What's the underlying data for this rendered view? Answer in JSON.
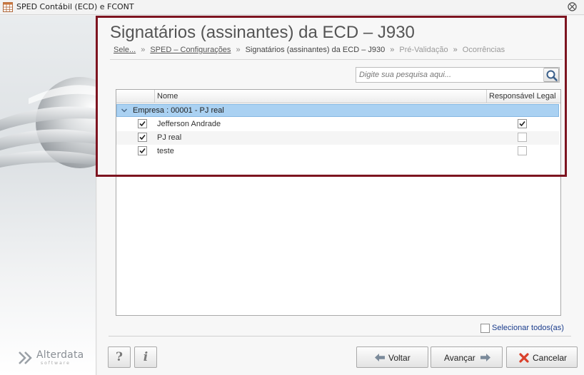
{
  "window": {
    "title": "SPED Contábil (ECD) e FCONT",
    "close_glyph": "⨂"
  },
  "header": {
    "title": "Signatários (assinantes) da ECD – J930",
    "breadcrumb": {
      "items": [
        "Sele...",
        "SPED – Configurações",
        "Signatários (assinantes) da ECD – J930",
        "Pré-Validação",
        "Ocorrências"
      ],
      "separator": "»"
    }
  },
  "search": {
    "placeholder": "Digite sua pesquisa aqui...",
    "value": "",
    "icon": "magnifier-icon"
  },
  "grid": {
    "columns": [
      "Nome",
      "Responsável Legal"
    ],
    "group": {
      "label": "Empresa : 00001 - PJ real",
      "expanded": true
    },
    "rows": [
      {
        "name": "Jefferson Andrade",
        "selected": true,
        "responsavel_legal": true
      },
      {
        "name": "PJ real",
        "selected": true,
        "responsavel_legal": false
      },
      {
        "name": "teste",
        "selected": true,
        "responsavel_legal": false
      }
    ]
  },
  "select_all": {
    "label": "Selecionar todos(as)",
    "checked": false
  },
  "footer": {
    "help_label": "?",
    "info_label": "i",
    "voltar_label": "Voltar",
    "avancar_label": "Avançar",
    "cancelar_label": "Cancelar"
  },
  "brand": {
    "name": "Alterdata",
    "subtitle": "software"
  },
  "colors": {
    "highlight_frame": "#7d1420",
    "group_row": "#aad1f2",
    "link": "#1a3c8c",
    "cancel_icon": "#d9402b",
    "arrow_icon": "#7b8a9a"
  }
}
